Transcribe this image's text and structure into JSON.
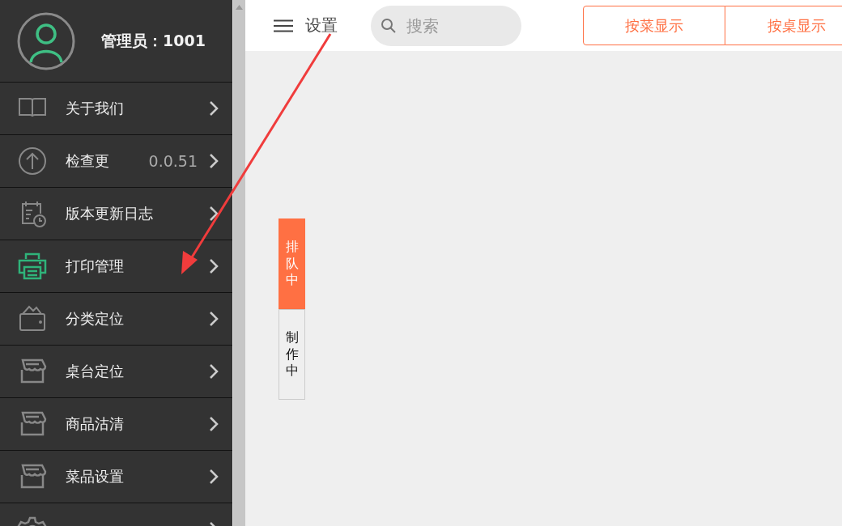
{
  "profile": {
    "name": "管理员：1001"
  },
  "menu": [
    {
      "label": "关于我们",
      "active": false
    },
    {
      "label": "检查更",
      "value": "0.0.51",
      "active": false
    },
    {
      "label": "版本更新日志",
      "active": false
    },
    {
      "label": "打印管理",
      "active": true
    },
    {
      "label": "分类定位",
      "active": false
    },
    {
      "label": "桌台定位",
      "active": false
    },
    {
      "label": "商品沽清",
      "active": false
    },
    {
      "label": "菜品设置",
      "active": false
    },
    {
      "active": false
    }
  ],
  "header": {
    "title": "设置",
    "search": {
      "placeholder": "搜索"
    }
  },
  "view_buttons": [
    {
      "label": "按菜显示",
      "selected": false
    },
    {
      "label": "按桌显示",
      "selected": false
    }
  ],
  "status_tabs": [
    {
      "label": "排队中",
      "selected": true
    },
    {
      "label": "制作中",
      "selected": false
    }
  ]
}
